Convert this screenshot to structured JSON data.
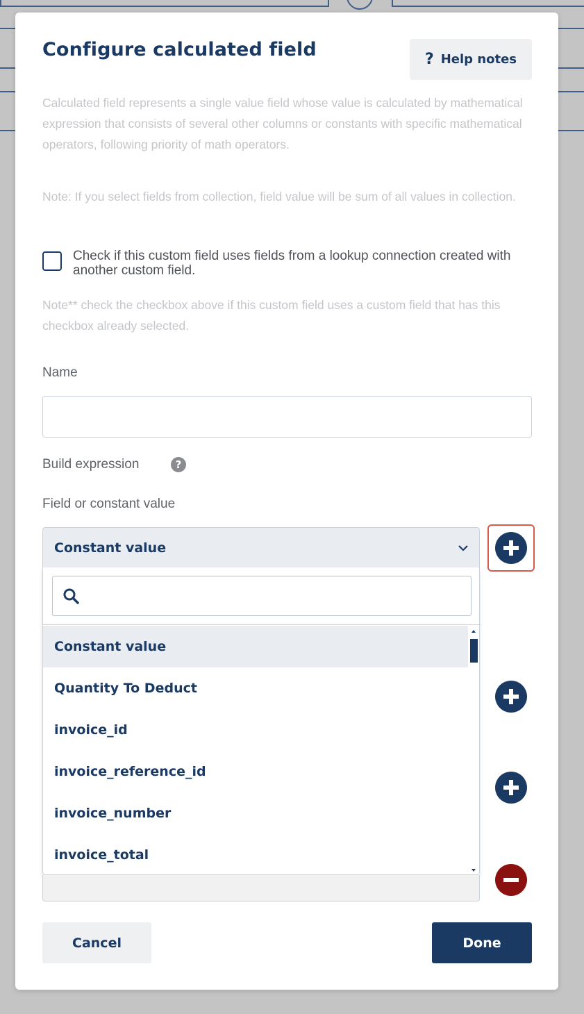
{
  "modal": {
    "title": "Configure calculated field",
    "help_label": "Help notes",
    "description": "Calculated field represents a single value field whose value is calculated by mathematical expression that consists of several other columns or constants with specific mathematical operators, following priority of math operators.",
    "note_collection": "Note: If you select fields from collection, field value will be sum of all values in collection.",
    "lookup_checkbox_label": "Check if this custom field uses fields from a lookup connection created with another custom field.",
    "note_checkbox": "Note** check the checkbox above if this custom field uses a custom field that has this checkbox already selected.",
    "name_label": "Name",
    "name_value": "",
    "build_expression_label": "Build expression",
    "field_or_constant_label": "Field or constant value",
    "selected_value": "Constant value",
    "search_value": "",
    "options": [
      "Constant value",
      "Quantity To Deduct",
      "invoice_id",
      "invoice_reference_id",
      "invoice_number",
      "invoice_total"
    ],
    "cancel_label": "Cancel",
    "done_label": "Done"
  },
  "icons": {
    "help": "question-mark-icon",
    "info": "info-icon",
    "chevron": "chevron-down-icon",
    "search": "search-icon",
    "add": "plus-circle-icon",
    "remove": "minus-circle-icon"
  },
  "colors": {
    "primary": "#1b3a63",
    "danger": "#8b1010",
    "highlight": "#d75a4a",
    "overlay": "#c4c4c4"
  }
}
